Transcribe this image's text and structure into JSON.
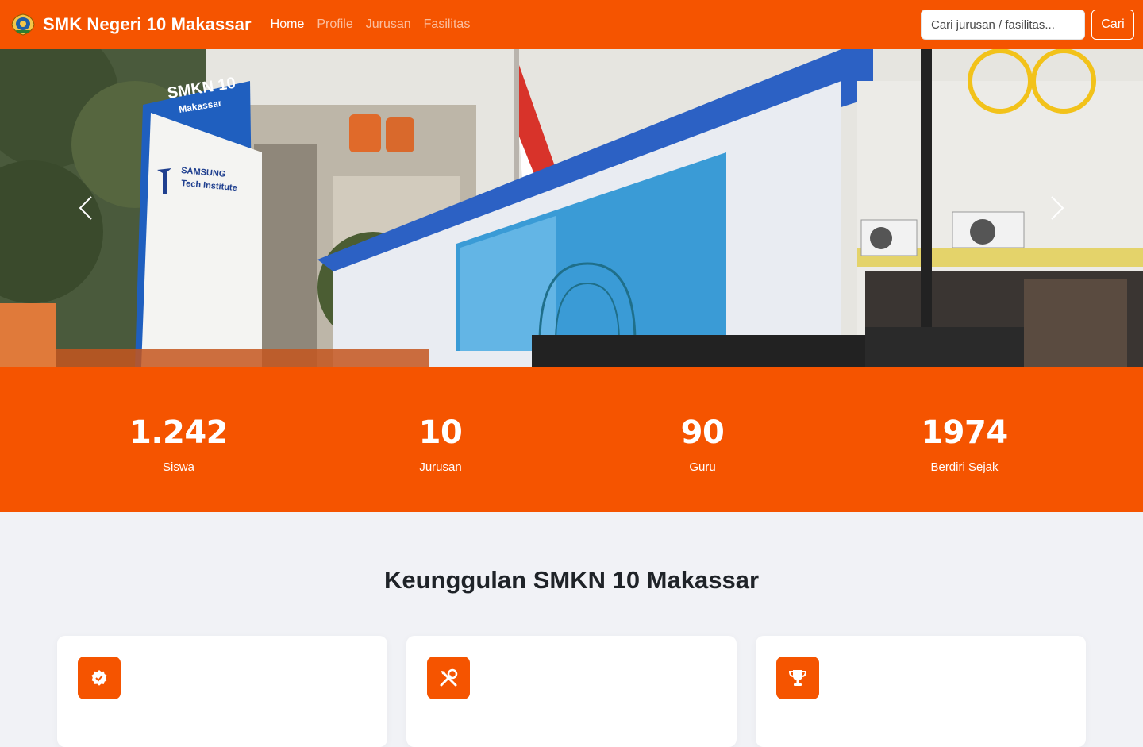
{
  "navbar": {
    "brand_icon": "school-emblem-icon",
    "brand_title": "SMK Negeri 10 Makassar",
    "links": [
      {
        "label": "Home",
        "active": true
      },
      {
        "label": "Profile",
        "active": false
      },
      {
        "label": "Jurusan",
        "active": false
      },
      {
        "label": "Fasilitas",
        "active": false
      }
    ],
    "search_placeholder": "Cari jurusan / fasilitas...",
    "search_button": "Cari"
  },
  "hero": {
    "sign_text_line1": "SMKN 10",
    "sign_text_line2": "Makassar",
    "sign_sponsor_line1": "SAMSUNG",
    "sign_sponsor_line2": "Tech Institute",
    "prev_icon": "chevron-left-icon",
    "next_icon": "chevron-right-icon"
  },
  "stats": [
    {
      "value": "1.242",
      "label": "Siswa"
    },
    {
      "value": "10",
      "label": "Jurusan"
    },
    {
      "value": "90",
      "label": "Guru"
    },
    {
      "value": "1974",
      "label": "Berdiri Sejak"
    }
  ],
  "features": {
    "title": "Keunggulan SMKN 10 Makassar",
    "cards": [
      {
        "icon": "verified-badge-icon"
      },
      {
        "icon": "tools-icon"
      },
      {
        "icon": "trophy-icon"
      }
    ]
  },
  "colors": {
    "brand": "#f55400",
    "background": "#f1f2f6",
    "text": "#1f2328"
  }
}
